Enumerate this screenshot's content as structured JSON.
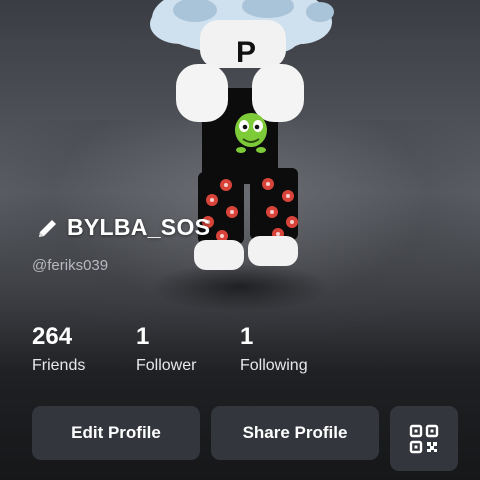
{
  "profile": {
    "display_name": "BYLBA_SOS",
    "username": "@feriks039"
  },
  "stats": [
    {
      "value": "264",
      "label": "Friends"
    },
    {
      "value": "1",
      "label": "Follower"
    },
    {
      "value": "1",
      "label": "Following"
    }
  ],
  "actions": {
    "edit_label": "Edit Profile",
    "share_label": "Share Profile"
  },
  "icons": {
    "edit": "pencil-icon",
    "qr": "qr-code-icon"
  },
  "colors": {
    "background": "#1b1c1f",
    "button": "#33363d",
    "text": "#ffffff",
    "secondary_text": "#b7b9bf"
  }
}
